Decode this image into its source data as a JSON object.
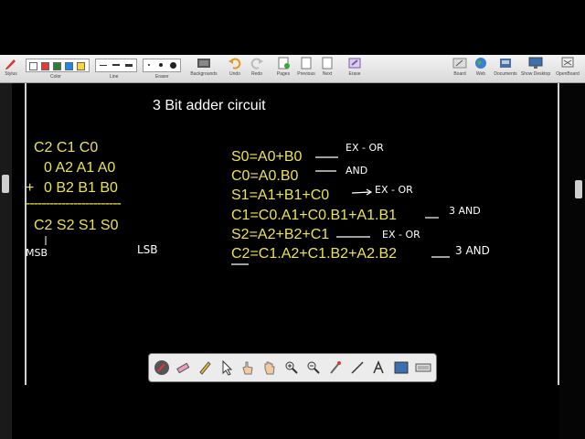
{
  "toolbar": {
    "stylus": "Stylus",
    "color": "Color",
    "line": "Line",
    "eraser": "Eraser",
    "backgrounds": "Backgrounds",
    "undo": "Undo",
    "redo": "Redo",
    "pages": "Pages",
    "previous": "Previous",
    "next": "Next",
    "erase": "Erase",
    "board": "Board",
    "web": "Web",
    "documents": "Documents",
    "show_desktop": "Show Desktop",
    "openboard": "OpenBoard",
    "swatch_colors": [
      "#ffffff",
      "#e53935",
      "#2e7d32",
      "#1e88e5",
      "#fdd835"
    ]
  },
  "board": {
    "title": "3 Bit adder circuit",
    "row_carry": "C2  C1   C0",
    "row_a": "0  A2    A1    A0",
    "row_plus": "+",
    "row_b": "0  B2   B1    B0",
    "dashes": "------------------------",
    "row_sum": "C2  S2  S1    S0",
    "msb": "MSB",
    "lsb": "LSB",
    "equations": [
      "S0=A0+B0",
      "C0=A0.B0",
      "S1=A1+B1+C0",
      "C1=C0.A1+C0.B1+A1.B1",
      "S2=A2+B2+C1",
      "C2=C1.A2+C1.B2+A2.B2"
    ],
    "notes": [
      "EX - OR",
      "AND",
      "EX - OR",
      "3 AND",
      "EX - OR",
      "3 AND"
    ]
  },
  "palette_tools": [
    "pen-icon",
    "eraser-icon",
    "marker-icon",
    "pointer-icon",
    "hand-pointer-icon",
    "hand-icon",
    "zoom-in-icon",
    "zoom-out-icon",
    "laser-icon",
    "line-icon",
    "text-icon",
    "capture-icon",
    "keyboard-icon"
  ]
}
